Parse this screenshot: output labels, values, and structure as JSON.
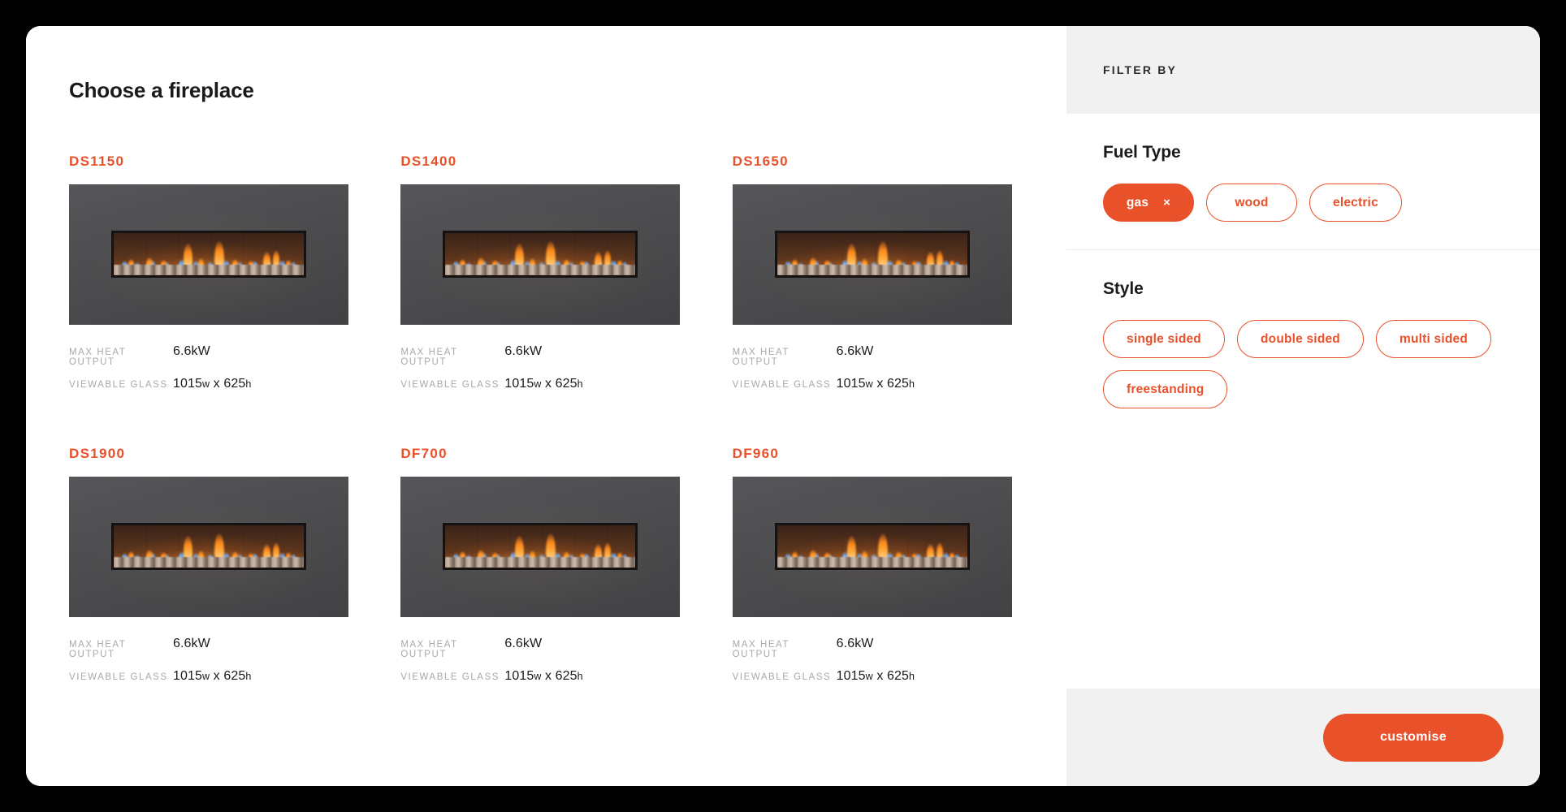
{
  "theme": {
    "accent": "#E8512A",
    "page_background": "#000000",
    "panel_background": "#FFFFFF",
    "band_background": "#F1F1F1",
    "image_background": "#4A4A4C",
    "label_text": "#A8A8A8",
    "body_text": "#1A1A1A"
  },
  "main": {
    "title": "Choose a fireplace",
    "spec_labels": {
      "max_heat_output": "MAX HEAT OUTPUT",
      "viewable_glass": "VIEWABLE GLASS"
    },
    "products": [
      {
        "name": "DS1150",
        "max_heat_output": "6.6kW",
        "viewable_glass_width": "1015",
        "viewable_glass_w_unit": "w",
        "viewable_glass_sep": " x ",
        "viewable_glass_height": "625",
        "viewable_glass_h_unit": "h"
      },
      {
        "name": "DS1400",
        "max_heat_output": "6.6kW",
        "viewable_glass_width": "1015",
        "viewable_glass_w_unit": "w",
        "viewable_glass_sep": " x ",
        "viewable_glass_height": "625",
        "viewable_glass_h_unit": "h"
      },
      {
        "name": "DS1650",
        "max_heat_output": "6.6kW",
        "viewable_glass_width": "1015",
        "viewable_glass_w_unit": "w",
        "viewable_glass_sep": " x ",
        "viewable_glass_height": "625",
        "viewable_glass_h_unit": "h"
      },
      {
        "name": "DS1900",
        "max_heat_output": "6.6kW",
        "viewable_glass_width": "1015",
        "viewable_glass_w_unit": "w",
        "viewable_glass_sep": " x ",
        "viewable_glass_height": "625",
        "viewable_glass_h_unit": "h"
      },
      {
        "name": "DF700",
        "max_heat_output": "6.6kW",
        "viewable_glass_width": "1015",
        "viewable_glass_w_unit": "w",
        "viewable_glass_sep": " x ",
        "viewable_glass_height": "625",
        "viewable_glass_h_unit": "h"
      },
      {
        "name": "DF960",
        "max_heat_output": "6.6kW",
        "viewable_glass_width": "1015",
        "viewable_glass_w_unit": "w",
        "viewable_glass_sep": " x ",
        "viewable_glass_height": "625",
        "viewable_glass_h_unit": "h"
      }
    ]
  },
  "sidebar": {
    "header_title": "FILTER BY",
    "sections": [
      {
        "title": "Fuel Type",
        "options": [
          {
            "label": "gas",
            "selected": true,
            "close_icon": "×"
          },
          {
            "label": "wood",
            "selected": false
          },
          {
            "label": "electric",
            "selected": false
          }
        ]
      },
      {
        "title": "Style",
        "options": [
          {
            "label": "single sided",
            "selected": false
          },
          {
            "label": "double sided",
            "selected": false
          },
          {
            "label": "multi sided",
            "selected": false
          },
          {
            "label": "freestanding",
            "selected": false
          }
        ]
      }
    ],
    "footer": {
      "customise_label": "customise"
    }
  }
}
